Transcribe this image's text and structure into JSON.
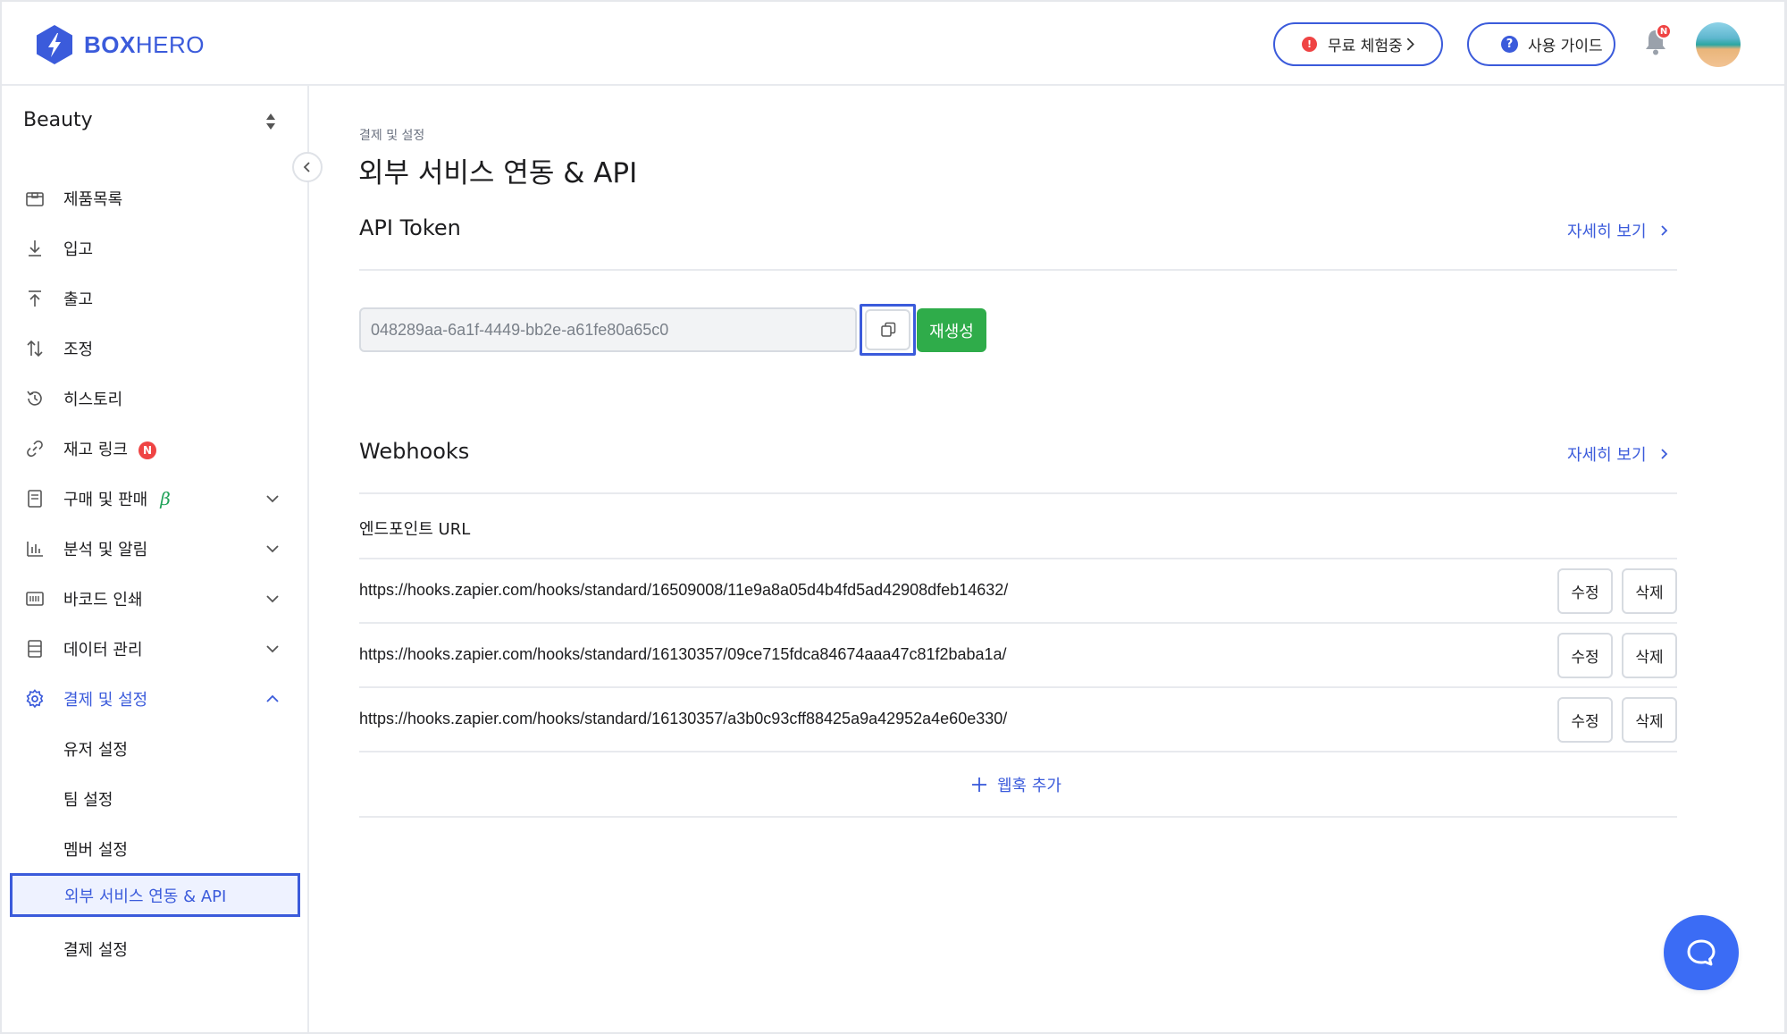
{
  "header": {
    "logo_bold": "BOX",
    "logo_light": "HERO",
    "trial_badge": "!",
    "trial_label": "무료 체험중",
    "guide_badge": "?",
    "guide_label": "사용 가이드",
    "notification_badge": "N"
  },
  "sidebar": {
    "team_name": "Beauty",
    "items": [
      {
        "label": "제품목록",
        "icon": "box-icon"
      },
      {
        "label": "입고",
        "icon": "download-icon"
      },
      {
        "label": "출고",
        "icon": "upload-icon"
      },
      {
        "label": "조정",
        "icon": "swap-icon"
      },
      {
        "label": "히스토리",
        "icon": "history-icon"
      },
      {
        "label": "재고 링크",
        "icon": "link-icon",
        "badge": "N"
      },
      {
        "label": "구매 및 판매",
        "icon": "document-icon",
        "beta": "β"
      },
      {
        "label": "분석 및 알림",
        "icon": "bar-chart-icon"
      },
      {
        "label": "바코드 인쇄",
        "icon": "barcode-icon"
      },
      {
        "label": "데이터 관리",
        "icon": "database-icon"
      },
      {
        "label": "결제 및 설정",
        "icon": "gear-icon"
      }
    ],
    "sub_items": [
      "유저 설정",
      "팀 설정",
      "멤버 설정",
      "외부 서비스 연동 & API",
      "결제 설정"
    ]
  },
  "main": {
    "breadcrumb": "결제 및 설정",
    "title": "외부 서비스 연동 & API",
    "api": {
      "section_title": "API Token",
      "more_link": "자세히 보기",
      "token_value": "048289aa-6a1f-4449-bb2e-a61fe80a65c0",
      "regenerate_label": "재생성"
    },
    "webhooks": {
      "section_title": "Webhooks",
      "more_link": "자세히 보기",
      "column_header": "엔드포인트 URL",
      "rows": [
        {
          "url": "https://hooks.zapier.com/hooks/standard/16509008/11e9a8a05d4b4fd5ad42908dfeb14632/",
          "edit": "수정",
          "delete": "삭제"
        },
        {
          "url": "https://hooks.zapier.com/hooks/standard/16130357/09ce715fdca84674aaa47c81f2baba1a/",
          "edit": "수정",
          "delete": "삭제"
        },
        {
          "url": "https://hooks.zapier.com/hooks/standard/16130357/a3b0c93cff88425a9a42952a4e60e330/",
          "edit": "수정",
          "delete": "삭제"
        }
      ],
      "add_label": "웹훅 추가"
    }
  },
  "colors": {
    "accent": "#3b5bdb",
    "success": "#2fac4a",
    "danger": "#ef4444",
    "chat": "#3b6cf5"
  }
}
